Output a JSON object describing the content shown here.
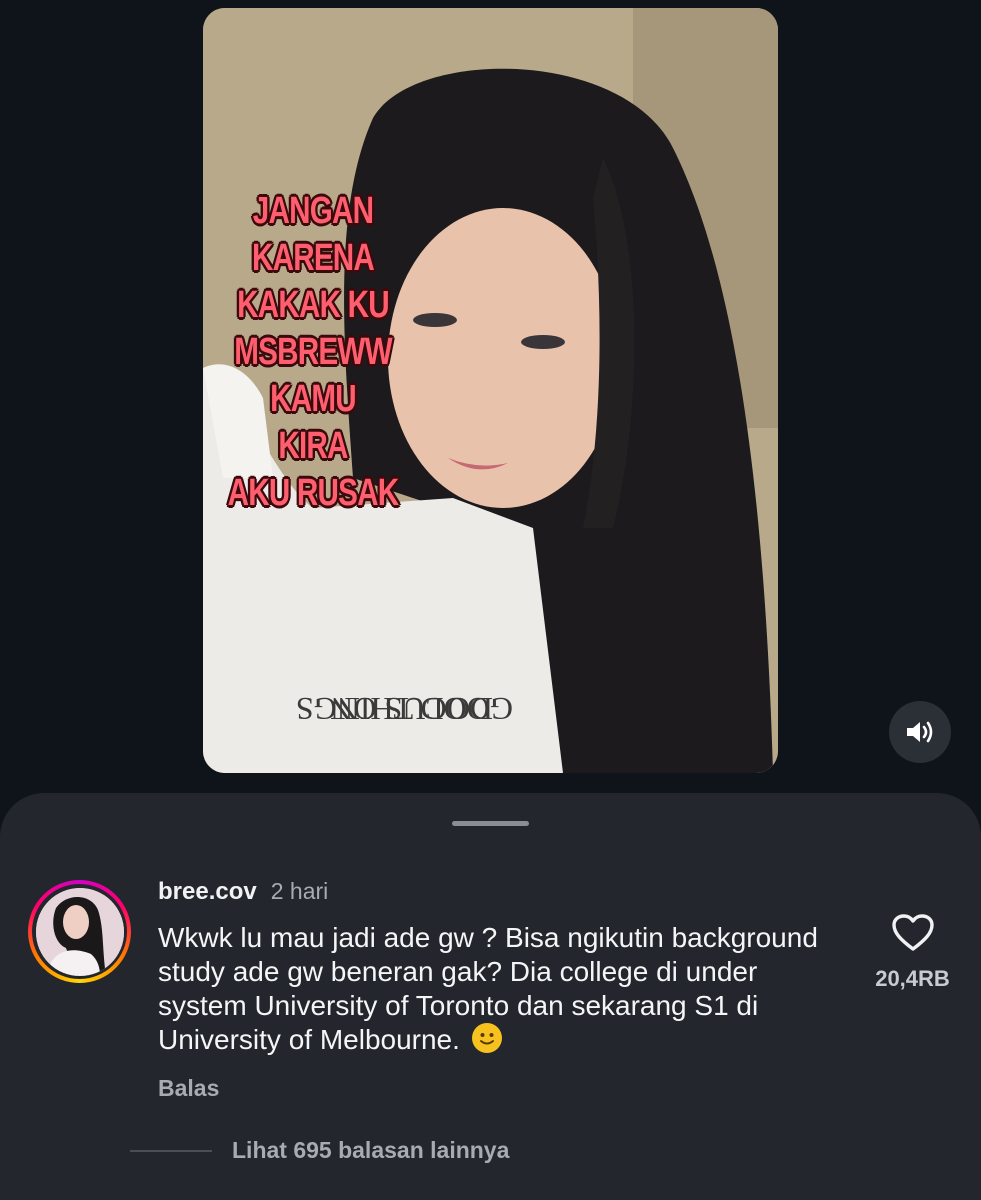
{
  "video": {
    "caption_lines": [
      "JANGAN",
      "KARENA",
      "KAKAK KU",
      "MSBREWW",
      "KAMU",
      "KIRA",
      "AKU RUSAK"
    ],
    "volume_icon": "volume-icon"
  },
  "comment": {
    "username": "bree.cov",
    "time": "2 hari",
    "text": "Wkwk lu mau jadi ade gw ? Bisa ngikutin background study ade gw beneran gak? Dia college di under system University of Toronto dan sekarang S1 di University of Melbourne.",
    "emoji": "smiling-face-icon",
    "reply_label": "Balas",
    "like_icon": "heart-icon",
    "like_count": "20,4RB",
    "view_replies_label": "Lihat 695 balasan lainnya"
  },
  "colors": {
    "background": "#0f131a",
    "sheet": "#23262c",
    "caption_text": "#ff5e6e"
  }
}
